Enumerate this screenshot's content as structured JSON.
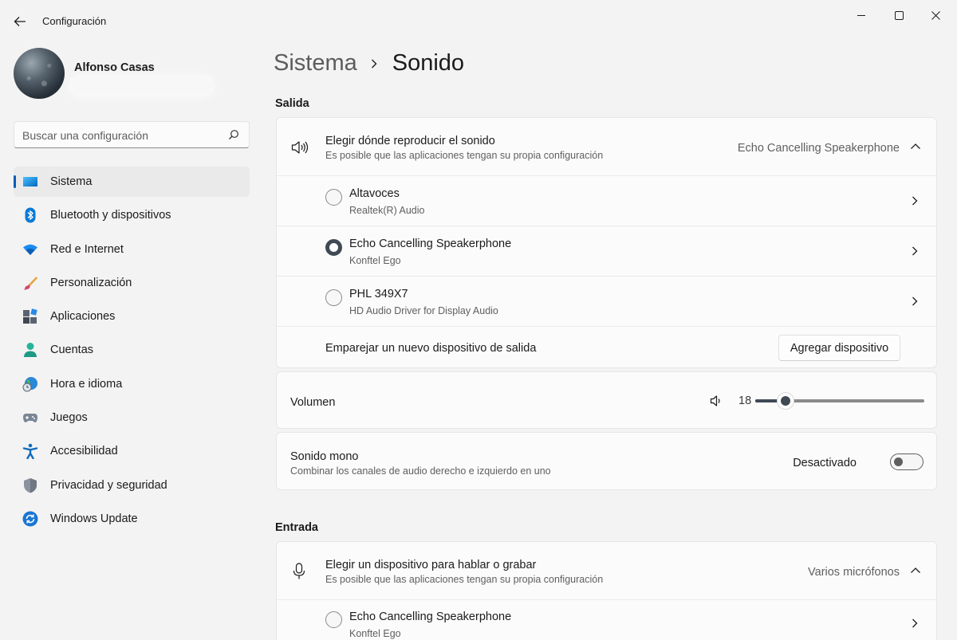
{
  "window": {
    "title": "Configuración"
  },
  "user": {
    "name": "Alfonso Casas"
  },
  "search": {
    "placeholder": "Buscar una configuración"
  },
  "sidebar": {
    "items": [
      {
        "label": "Sistema",
        "icon": "system-icon",
        "active": true
      },
      {
        "label": "Bluetooth y dispositivos",
        "icon": "bluetooth-icon"
      },
      {
        "label": "Red e Internet",
        "icon": "wifi-icon"
      },
      {
        "label": "Personalización",
        "icon": "paintbrush-icon"
      },
      {
        "label": "Aplicaciones",
        "icon": "apps-icon"
      },
      {
        "label": "Cuentas",
        "icon": "account-icon"
      },
      {
        "label": "Hora e idioma",
        "icon": "globe-clock-icon"
      },
      {
        "label": "Juegos",
        "icon": "gamepad-icon"
      },
      {
        "label": "Accesibilidad",
        "icon": "accessibility-icon"
      },
      {
        "label": "Privacidad y seguridad",
        "icon": "shield-icon"
      },
      {
        "label": "Windows Update",
        "icon": "update-icon"
      }
    ]
  },
  "breadcrumb": {
    "parent": "Sistema",
    "current": "Sonido"
  },
  "output": {
    "section_title": "Salida",
    "choose": {
      "title": "Elegir dónde reproducir el sonido",
      "subtitle": "Es posible que las aplicaciones tengan su propia configuración",
      "value": "Echo Cancelling Speakerphone"
    },
    "devices": [
      {
        "name": "Altavoces",
        "driver": "Realtek(R) Audio",
        "selected": false
      },
      {
        "name": "Echo Cancelling Speakerphone",
        "driver": "Konftel Ego",
        "selected": true
      },
      {
        "name": "PHL 349X7",
        "driver": "HD Audio Driver for Display Audio",
        "selected": false
      }
    ],
    "pair": {
      "label": "Emparejar un nuevo dispositivo de salida",
      "button": "Agregar dispositivo"
    },
    "volume": {
      "label": "Volumen",
      "value": "18",
      "level": 0.18
    },
    "mono": {
      "title": "Sonido mono",
      "subtitle": "Combinar los canales de audio derecho e izquierdo en uno",
      "state": "Desactivado",
      "on": false
    }
  },
  "input": {
    "section_title": "Entrada",
    "choose": {
      "title": "Elegir un dispositivo para hablar o grabar",
      "subtitle": "Es posible que las aplicaciones tengan su propia configuración",
      "value": "Varios micrófonos"
    },
    "devices": [
      {
        "name": "Echo Cancelling Speakerphone",
        "driver": "Konftel Ego",
        "selected": false
      }
    ]
  }
}
